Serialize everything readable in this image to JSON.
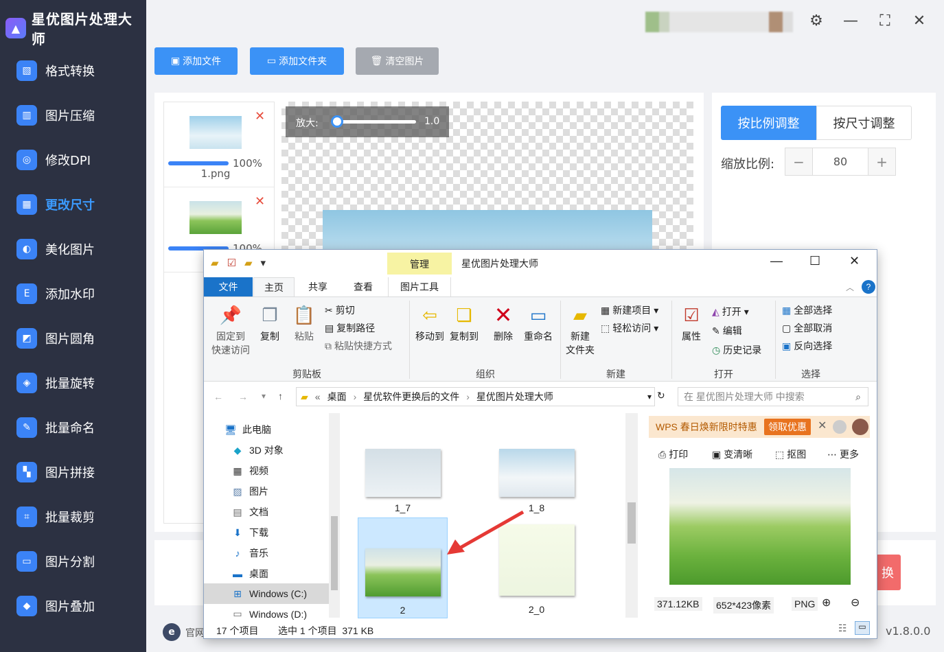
{
  "app": {
    "title": "星优图片处理大师",
    "version": "v1.8.0.0",
    "footer_link": "官网"
  },
  "sidebar": {
    "items": [
      {
        "label": "格式转换",
        "icon": "format-convert-icon"
      },
      {
        "label": "图片压缩",
        "icon": "compress-icon"
      },
      {
        "label": "修改DPI",
        "icon": "dpi-icon"
      },
      {
        "label": "更改尺寸",
        "icon": "resize-icon",
        "active": true
      },
      {
        "label": "美化图片",
        "icon": "beautify-icon"
      },
      {
        "label": "添加水印",
        "icon": "watermark-icon"
      },
      {
        "label": "图片圆角",
        "icon": "round-corner-icon"
      },
      {
        "label": "批量旋转",
        "icon": "rotate-icon"
      },
      {
        "label": "批量命名",
        "icon": "rename-icon"
      },
      {
        "label": "图片拼接",
        "icon": "stitch-icon"
      },
      {
        "label": "批量裁剪",
        "icon": "crop-icon"
      },
      {
        "label": "图片分割",
        "icon": "split-icon"
      },
      {
        "label": "图片叠加",
        "icon": "overlay-icon"
      }
    ]
  },
  "toolbar": {
    "add_file": "添加文件",
    "add_folder": "添加文件夹",
    "clear": "清空图片"
  },
  "file_list": [
    {
      "name": "1.png",
      "progress": "100%"
    },
    {
      "name": "",
      "progress": "100%"
    }
  ],
  "zoom": {
    "label": "放大:",
    "value": "1.0",
    "level": 0.0
  },
  "settings": {
    "tab_ratio": "按比例调整",
    "tab_size": "按尺寸调整",
    "scale_label": "缩放比例:",
    "scale_value": "80",
    "minus": "−",
    "plus": "+"
  },
  "explorer": {
    "title": "星优图片处理大师",
    "context_tab": "管理",
    "tabs": [
      "文件",
      "主页",
      "共享",
      "查看",
      "图片工具"
    ],
    "ribbon": {
      "pin": "固定到\n快速访问",
      "copy": "复制",
      "paste": "粘贴",
      "cut": "剪切",
      "copy_path": "复制路径",
      "paste_shortcut": "粘贴快捷方式",
      "move_to": "移动到",
      "copy_to": "复制到",
      "delete": "删除",
      "rename": "重命名",
      "new_folder": "新建\n文件夹",
      "new_item": "新建项目",
      "easy_access": "轻松访问",
      "properties": "属性",
      "open": "打开",
      "edit": "编辑",
      "history": "历史记录",
      "select_all": "全部选择",
      "select_none": "全部取消",
      "invert": "反向选择",
      "groups": [
        "剪贴板",
        "组织",
        "新建",
        "打开",
        "选择"
      ]
    },
    "breadcrumb": [
      "«",
      "桌面",
      "星优软件更换后的文件",
      "星优图片处理大师"
    ],
    "search_placeholder": "在 星优图片处理大师 中搜索",
    "tree": [
      "此电脑",
      "3D 对象",
      "视频",
      "图片",
      "文档",
      "下载",
      "音乐",
      "桌面",
      "Windows (C:)",
      "Windows (D:)"
    ],
    "files": [
      "1_7",
      "1_8",
      "2",
      "2_0"
    ],
    "ad": {
      "text": "WPS 春日焕新限时特惠",
      "button": "领取优惠"
    },
    "preview_actions": [
      "打印",
      "变清晰",
      "抠图",
      "更多"
    ],
    "preview_info": {
      "size": "371.12KB",
      "dims": "652*423像素",
      "format": "PNG"
    },
    "status": {
      "count": "17 个项目",
      "selected": "选中 1 个项目  371 KB"
    }
  }
}
